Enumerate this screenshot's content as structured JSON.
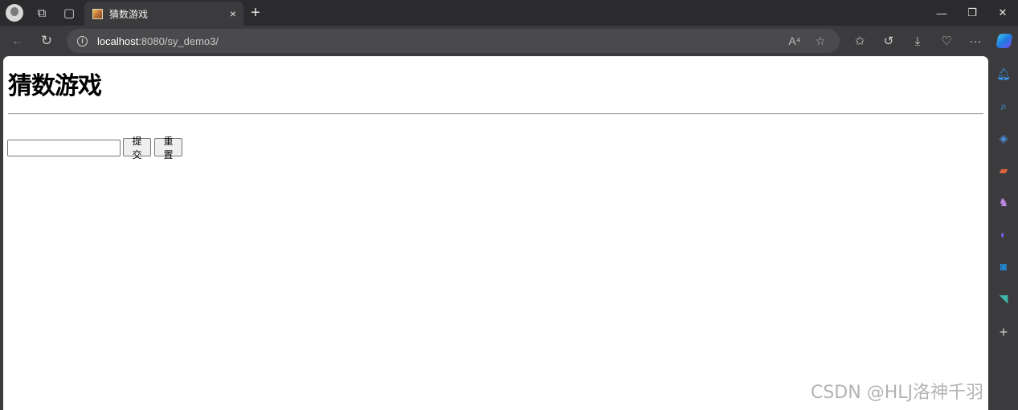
{
  "browser": {
    "tab": {
      "title": "猜数游戏",
      "close": "×"
    },
    "new_tab": "+",
    "window_controls": {
      "minimize": "—",
      "restore": "❐",
      "close": "✕"
    },
    "address": {
      "host": "localhost",
      "path": ":8080/sy_demo3/"
    },
    "read_aloud": "A⁴",
    "more": "···"
  },
  "page": {
    "heading": "猜数游戏",
    "input": {
      "value": "",
      "placeholder": ""
    },
    "submit_label": "提交",
    "reset_label": "重置"
  },
  "sidebar_icons": [
    "bell-icon",
    "search-icon",
    "tag-icon",
    "toolbox-icon",
    "games-icon",
    "copilot-icon",
    "outlook-icon",
    "drop-icon",
    "add-icon"
  ],
  "watermark": "CSDN @HLJ洛神千羽"
}
